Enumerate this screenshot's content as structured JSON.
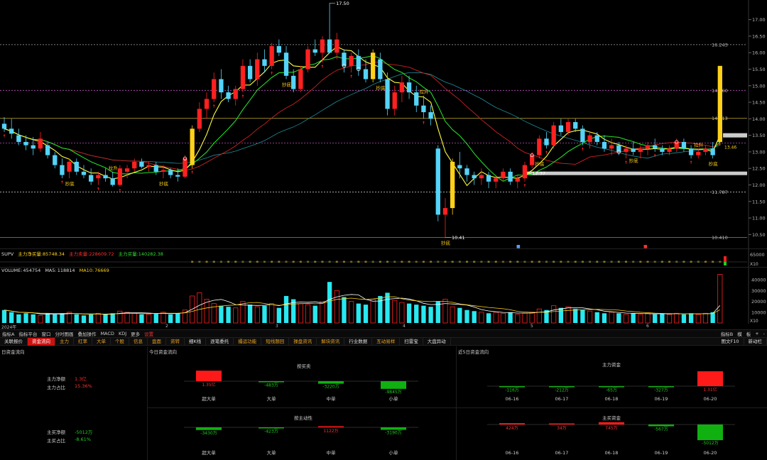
{
  "price_axis": {
    "labels": [
      "17.00",
      "16.50",
      "16.00",
      "15.50",
      "15.00",
      "14.50",
      "14.00",
      "13.50",
      "13.00",
      "12.50",
      "12.00",
      "11.50",
      "11.00",
      "10.50"
    ],
    "min": 10.25,
    "max": 17.55
  },
  "annotations": {
    "high_price": "17.50",
    "low_price": "10.41",
    "mid_price": "12.37",
    "level_16": "16.243",
    "level_14_8": "14.860",
    "level_14": "14.013",
    "level_11": "11.787",
    "level_10": "10.410",
    "current_price": "13.46",
    "chaodi": "抄底",
    "laoshen": "拉升"
  },
  "colors": {
    "up": "#ff2020",
    "down": "#54d4f8",
    "gold": "#ffd21a",
    "ma_yellow": "#ffff3c",
    "ma_green": "#22dd22",
    "ma_red": "#cc2222",
    "ma_teal": "#1f8d9a"
  },
  "supv": {
    "name": "SUPV",
    "main_net_label": "主力净买量:",
    "main_net": "85748.34",
    "main_sell_label": "主力卖量:",
    "main_sell": "228609.72",
    "main_buy_label": "主力买量:",
    "main_buy": "140282.38",
    "axis": "65000",
    "axis_unit": "X10"
  },
  "volume": {
    "name": "VOLUME:",
    "value": "454754",
    "ma5_label": "MA5:",
    "ma5": "118814",
    "ma10_label": "MA10:",
    "ma10": "76669",
    "axis": [
      "40000",
      "30000",
      "20000",
      "10000"
    ],
    "axis_unit": "X10"
  },
  "chart_data": {
    "type": "bar",
    "title": "",
    "candles": [
      [
        13.85,
        14.05,
        13.6,
        13.7
      ],
      [
        13.7,
        14.0,
        13.4,
        13.55
      ],
      [
        13.5,
        13.7,
        13.2,
        13.3
      ],
      [
        13.3,
        13.5,
        13.05,
        13.2
      ],
      [
        13.2,
        13.45,
        12.9,
        13.1
      ],
      [
        13.1,
        13.6,
        13.0,
        13.4
      ],
      [
        13.2,
        13.3,
        12.8,
        12.9
      ],
      [
        12.9,
        13.0,
        12.5,
        12.6
      ],
      [
        12.6,
        12.8,
        12.2,
        12.3
      ],
      [
        12.4,
        12.8,
        12.2,
        12.7
      ],
      [
        12.7,
        12.8,
        12.3,
        12.4
      ],
      [
        12.4,
        12.6,
        12.2,
        12.3
      ],
      [
        12.3,
        12.5,
        12.0,
        12.1
      ],
      [
        12.2,
        12.4,
        12.0,
        12.3
      ],
      [
        12.3,
        12.5,
        12.1,
        12.2
      ],
      [
        12.2,
        12.4,
        11.95,
        12.0
      ],
      [
        12.0,
        12.6,
        11.95,
        12.5
      ],
      [
        12.4,
        12.6,
        12.2,
        12.5
      ],
      [
        12.5,
        12.8,
        12.4,
        12.7
      ],
      [
        12.7,
        12.8,
        12.5,
        12.55
      ],
      [
        12.55,
        12.7,
        12.4,
        12.6
      ],
      [
        12.6,
        12.7,
        12.3,
        12.4
      ],
      [
        12.4,
        12.6,
        12.2,
        12.45
      ],
      [
        12.45,
        12.5,
        12.2,
        12.3
      ],
      [
        12.3,
        12.5,
        12.1,
        12.25
      ],
      [
        12.25,
        12.9,
        12.2,
        12.8
      ],
      [
        12.6,
        13.8,
        12.5,
        13.7
      ],
      [
        13.7,
        14.5,
        13.6,
        14.3
      ],
      [
        14.3,
        14.8,
        14.0,
        14.6
      ],
      [
        14.6,
        15.4,
        14.5,
        15.2
      ],
      [
        15.2,
        15.5,
        14.6,
        14.8
      ],
      [
        14.8,
        15.0,
        14.5,
        14.6
      ],
      [
        14.6,
        15.0,
        14.4,
        14.9
      ],
      [
        14.9,
        15.8,
        14.8,
        15.6
      ],
      [
        15.6,
        15.8,
        15.1,
        15.2
      ],
      [
        15.2,
        16.0,
        15.0,
        15.8
      ],
      [
        15.8,
        16.1,
        15.4,
        15.6
      ],
      [
        15.6,
        16.3,
        15.5,
        16.2
      ],
      [
        16.2,
        16.4,
        15.9,
        16.0
      ],
      [
        16.0,
        16.2,
        15.2,
        15.3
      ],
      [
        15.3,
        15.5,
        14.8,
        14.9
      ],
      [
        14.9,
        15.6,
        14.8,
        15.5
      ],
      [
        15.5,
        16.2,
        15.4,
        16.1
      ],
      [
        16.1,
        16.4,
        15.9,
        16.0
      ],
      [
        16.0,
        16.5,
        15.7,
        16.4
      ],
      [
        16.4,
        17.5,
        16.0,
        16.0
      ],
      [
        16.0,
        16.6,
        15.8,
        16.4
      ],
      [
        16.0,
        16.1,
        15.4,
        15.6
      ],
      [
        15.6,
        16.0,
        15.4,
        15.9
      ],
      [
        15.9,
        16.1,
        15.3,
        15.5
      ],
      [
        15.5,
        15.8,
        15.1,
        15.2
      ],
      [
        15.2,
        16.1,
        15.1,
        16.0
      ],
      [
        15.8,
        16.0,
        15.1,
        15.2
      ],
      [
        15.2,
        15.4,
        14.1,
        14.3
      ],
      [
        14.3,
        15.0,
        14.1,
        14.8
      ],
      [
        14.8,
        15.3,
        14.5,
        15.1
      ],
      [
        15.1,
        15.3,
        14.6,
        14.8
      ],
      [
        14.8,
        15.0,
        14.2,
        14.4
      ],
      [
        14.4,
        14.7,
        14.0,
        14.2
      ],
      [
        14.2,
        14.4,
        13.8,
        14.0
      ],
      [
        13.1,
        13.2,
        10.9,
        11.1
      ],
      [
        11.1,
        11.6,
        10.41,
        11.3
      ],
      [
        11.3,
        12.8,
        11.1,
        12.7
      ],
      [
        12.6,
        13.0,
        12.2,
        12.5
      ],
      [
        12.5,
        12.6,
        12.1,
        12.3
      ],
      [
        12.3,
        12.4,
        12.0,
        12.2
      ],
      [
        12.2,
        12.5,
        12.0,
        12.3
      ],
      [
        12.3,
        12.4,
        11.9,
        12.1
      ],
      [
        12.1,
        12.3,
        11.9,
        12.2
      ],
      [
        12.2,
        12.5,
        12.1,
        12.4
      ],
      [
        12.4,
        12.5,
        12.0,
        12.1
      ],
      [
        12.1,
        12.3,
        11.9,
        12.2
      ],
      [
        12.2,
        12.7,
        12.1,
        12.6
      ],
      [
        12.6,
        13.0,
        12.5,
        12.9
      ],
      [
        12.9,
        13.5,
        12.8,
        13.4
      ],
      [
        13.4,
        13.6,
        13.1,
        13.2
      ],
      [
        13.2,
        13.9,
        13.1,
        13.8
      ],
      [
        13.8,
        14.0,
        13.5,
        13.6
      ],
      [
        13.6,
        14.0,
        13.5,
        13.9
      ],
      [
        13.9,
        14.0,
        13.6,
        13.7
      ],
      [
        13.7,
        13.8,
        13.2,
        13.3
      ],
      [
        13.3,
        13.6,
        13.1,
        13.5
      ],
      [
        13.5,
        13.6,
        13.2,
        13.3
      ],
      [
        13.3,
        13.5,
        13.0,
        13.1
      ],
      [
        13.1,
        13.4,
        12.9,
        13.2
      ],
      [
        13.2,
        13.3,
        12.9,
        13.0
      ],
      [
        13.0,
        13.2,
        12.8,
        13.1
      ],
      [
        13.1,
        13.3,
        12.9,
        13.0
      ],
      [
        13.0,
        13.2,
        12.8,
        13.1
      ],
      [
        13.1,
        13.3,
        12.9,
        13.2
      ],
      [
        13.2,
        13.4,
        13.0,
        13.1
      ],
      [
        13.1,
        13.2,
        12.9,
        13.0
      ],
      [
        13.0,
        13.2,
        12.9,
        13.1
      ],
      [
        13.1,
        13.4,
        13.0,
        13.3
      ],
      [
        13.3,
        13.4,
        13.0,
        13.1
      ],
      [
        13.1,
        13.2,
        12.8,
        12.9
      ],
      [
        12.9,
        13.1,
        12.8,
        13.0
      ],
      [
        13.0,
        13.2,
        12.9,
        13.1
      ],
      [
        13.1,
        13.3,
        12.8,
        12.9
      ],
      [
        13.3,
        15.6,
        13.2,
        15.6
      ]
    ],
    "volume_bars": [
      12,
      10,
      8,
      9,
      8,
      7,
      9,
      8,
      9,
      10,
      8,
      7,
      8,
      9,
      8,
      9,
      11,
      10,
      9,
      8,
      8,
      9,
      10,
      8,
      9,
      12,
      25,
      28,
      22,
      18,
      16,
      15,
      14,
      20,
      17,
      15,
      16,
      18,
      14,
      25,
      22,
      18,
      17,
      16,
      20,
      38,
      30,
      24,
      20,
      18,
      17,
      22,
      25,
      28,
      21,
      19,
      18,
      17,
      16,
      15,
      20,
      22,
      15,
      14,
      12,
      11,
      10,
      9,
      10,
      9,
      10,
      8,
      9,
      10,
      13,
      12,
      16,
      14,
      15,
      13,
      12,
      11,
      10,
      9,
      10,
      9,
      8,
      9,
      8,
      9,
      8,
      9,
      8,
      9,
      8,
      9,
      8,
      9,
      10,
      45
    ]
  },
  "date_axis": {
    "start": "2024年",
    "marks": [
      "2",
      "3",
      "4",
      "5",
      "6"
    ]
  },
  "toolbar": {
    "left": [
      "指标A",
      "指标平台",
      "窗口",
      "分时图画",
      "叠加操作",
      "MACD",
      "KDJ",
      "更多",
      "设置"
    ],
    "right": [
      "指标B",
      "模",
      "板",
      "+",
      "-"
    ]
  },
  "tabs": [
    {
      "label": "关联报价",
      "style": "white"
    },
    {
      "label": "资金流向",
      "style": "active"
    },
    {
      "label": "主力",
      "style": "orange"
    },
    {
      "label": "红率",
      "style": "orange"
    },
    {
      "label": "大单",
      "style": "orange"
    },
    {
      "label": "个股",
      "style": "orange"
    },
    {
      "label": "信息",
      "style": "orange"
    },
    {
      "label": "盘面",
      "style": "orange"
    },
    {
      "label": "资转",
      "style": "orange"
    },
    {
      "label": "细K线",
      "style": "white"
    },
    {
      "label": "逐笔委托",
      "style": "white"
    },
    {
      "label": "撮运功能",
      "style": "orange"
    },
    {
      "label": "短线题回",
      "style": "orange"
    },
    {
      "label": "操盘资讯",
      "style": "orange"
    },
    {
      "label": "解块资讯",
      "style": "orange"
    },
    {
      "label": "行业数据",
      "style": "white"
    },
    {
      "label": "互动易样",
      "style": "orange"
    },
    {
      "label": "扫雷宝",
      "style": "white"
    },
    {
      "label": "大盘异动",
      "style": "white"
    }
  ],
  "tabs_right": [
    "图文F10",
    "新动栏"
  ],
  "panel_left": {
    "title": "日资金流向",
    "main_net_label": "主力净额",
    "main_net": "1.3亿",
    "main_ratio_label": "主力占比",
    "main_ratio": "15.36%",
    "active_net_label": "主买净额",
    "active_net": "-5012万",
    "active_ratio_label": "主买占比",
    "active_ratio": "-8.61%"
  },
  "panel_mid": {
    "title": "今日资金流向",
    "section1": "按买卖",
    "section2": "按主动性",
    "categories": [
      "超大单",
      "大单",
      "中单",
      "小单"
    ],
    "s1_values": [
      1.35,
      -0.0483,
      -0.322,
      -0.9845
    ],
    "s1_labels": [
      "1.35亿",
      "-483万",
      "-3220万",
      "-9845万"
    ],
    "s2_values": [
      -0.343,
      -0.0423,
      0.1122,
      -0.319
    ],
    "s2_labels": [
      "-3430万",
      "-423万",
      "1122万",
      "-3190万"
    ]
  },
  "panel_right": {
    "title": "近5日资金流向",
    "section1": "主力资金",
    "section2": "主买资金",
    "dates": [
      "06-16",
      "06-17",
      "06-18",
      "06-19",
      "06-20"
    ],
    "s1_values": [
      -0.0116,
      -0.0212,
      -0.0065,
      -0.0327,
      1.31
    ],
    "s1_labels": [
      "-116万",
      "-212万",
      "-65万",
      "-327万",
      "1.31亿"
    ],
    "s2_values": [
      0.0424,
      0.0034,
      0.0745,
      -0.0567,
      -0.5012
    ],
    "s2_labels": [
      "424万",
      "34万",
      "745万",
      "-567万",
      "-5012万"
    ]
  }
}
